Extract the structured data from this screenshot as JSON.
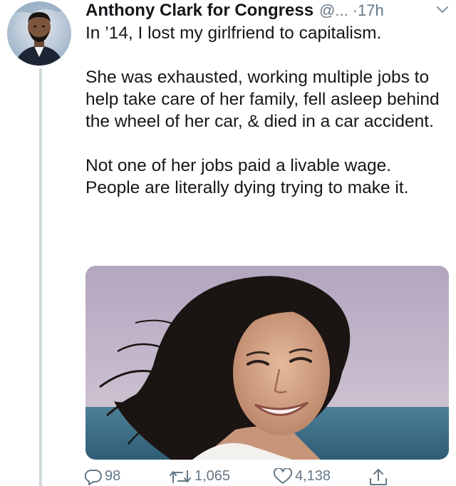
{
  "tweet": {
    "author_name": "Anthony Clark for Congress",
    "handle": "@...",
    "time": "·17h",
    "paragraphs": [
      "In ’14, I lost my girlfriend to capitalism.",
      "She was exhausted, working multiple jobs to help take care of her family, fell asleep behind the wheel of her car, & died in a car accident.",
      "Not one of her jobs paid a livable wage. People are literally dying trying to make it."
    ]
  },
  "actions": {
    "reply_count": "98",
    "retweet_count": "1,065",
    "like_count": "4,138"
  },
  "icons": {
    "menu": "chevron-down-icon",
    "reply": "reply-icon",
    "retweet": "retweet-icon",
    "like": "heart-icon",
    "share": "share-icon"
  },
  "colors": {
    "text": "#14171a",
    "secondary": "#657786",
    "thread_line": "#cfd9de"
  }
}
